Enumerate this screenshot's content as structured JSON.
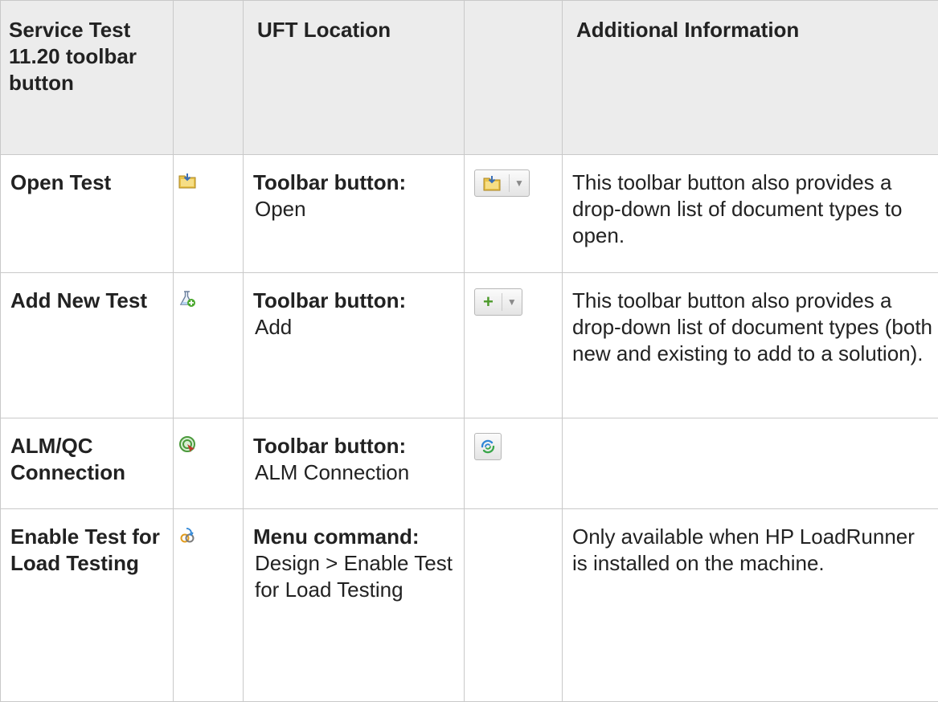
{
  "headers": {
    "col1": "Service Test 11.20 toolbar button",
    "col2": "",
    "col3": "UFT Location",
    "col4": "",
    "col5": "Additional Information"
  },
  "rows": [
    {
      "name": "Open Test",
      "st_icon": "open-folder-icon",
      "loc_label": "Toolbar button:",
      "loc_value": "Open",
      "uft_icon": "open-dropdown-button",
      "info": "This toolbar button also provides a drop-down list of document types to open."
    },
    {
      "name": "Add New Test",
      "st_icon": "flask-add-icon",
      "loc_label": "Toolbar button:",
      "loc_value": "Add",
      "uft_icon": "add-dropdown-button",
      "info": "This toolbar button also provides a drop-down list of document types (both new and existing to add to a solution)."
    },
    {
      "name": "ALM/QC Connection",
      "st_icon": "qc-connection-icon",
      "loc_label": "Toolbar button:",
      "loc_value": "ALM Connection",
      "uft_icon": "alm-connection-icon",
      "info": ""
    },
    {
      "name": "Enable Test for Load Testing",
      "st_icon": "load-testing-icon",
      "loc_label": "Menu command:",
      "loc_value": "Design > Enable Test for Load Testing",
      "uft_icon": "",
      "info": "Only available when HP LoadRunner is installed on the machine."
    }
  ],
  "colors": {
    "header_bg": "#ececec",
    "border": "#c9c9c9",
    "text": "#222222"
  }
}
